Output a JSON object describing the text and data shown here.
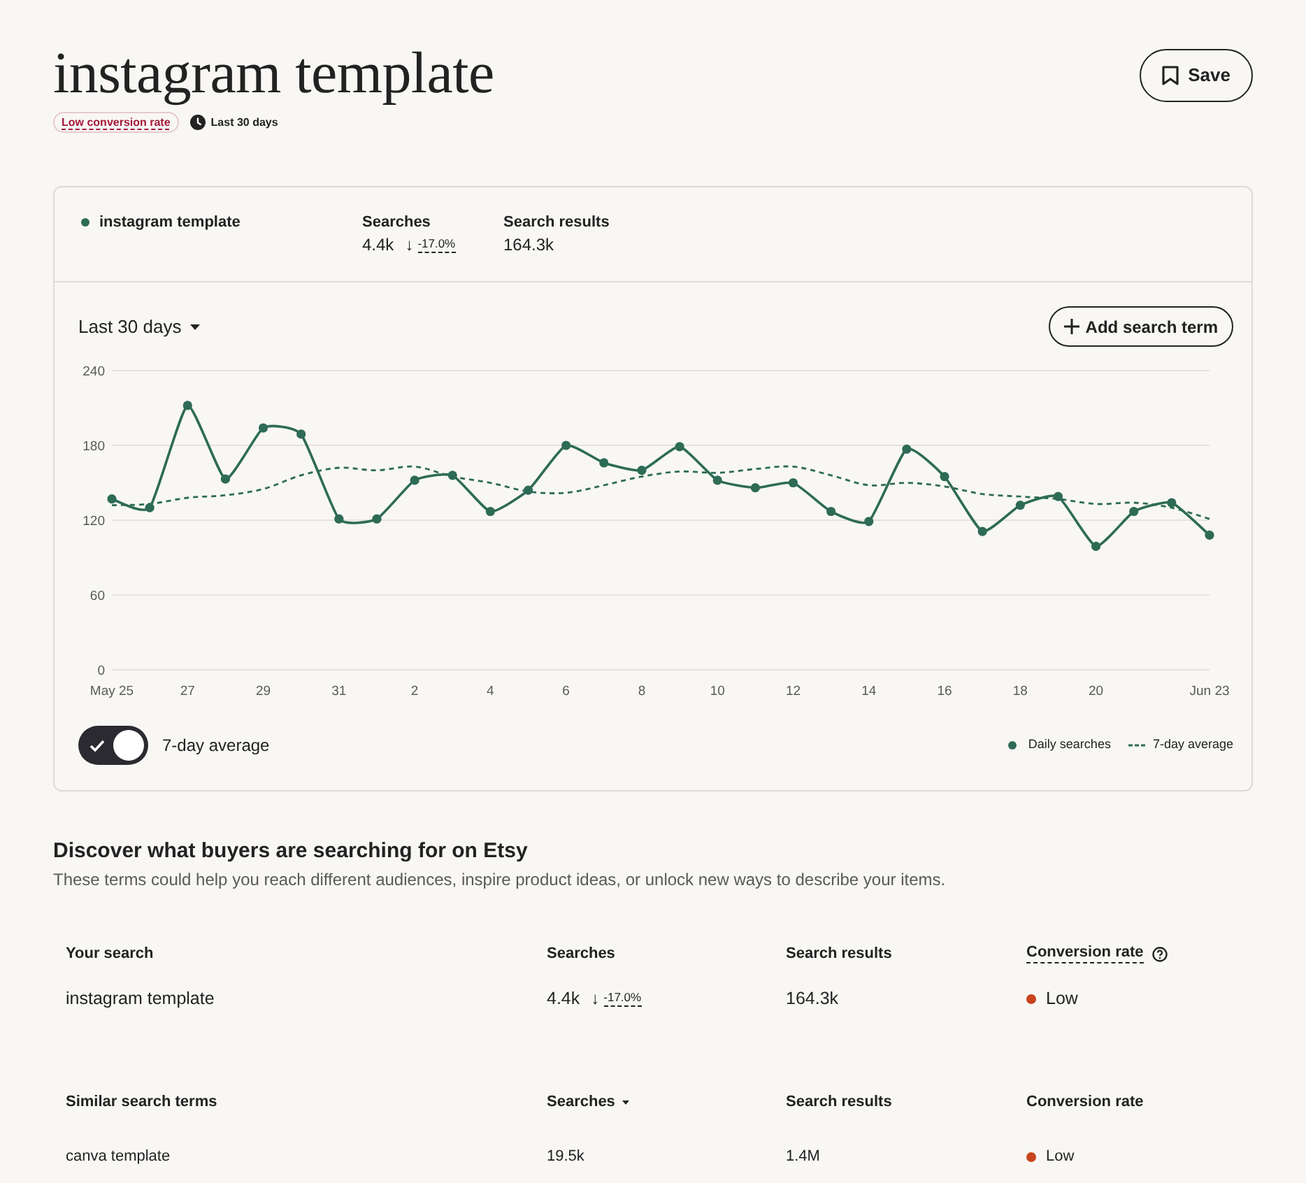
{
  "header": {
    "title": "instagram template",
    "badge": "Low conversion rate",
    "period": "Last 30 days",
    "save_label": "Save"
  },
  "summary": {
    "term": "instagram template",
    "color": "#2e6b56",
    "stats": [
      {
        "label": "Searches",
        "value": "4.4k",
        "arrow": "↓",
        "change": "-17.0%"
      },
      {
        "label": "Search results",
        "value": "164.3k"
      }
    ]
  },
  "chart_panel": {
    "range": "Last 30 days",
    "add_button": "Add search term",
    "chart_data": {
      "type": "line",
      "grid": true,
      "categories": [
        "May 25",
        null,
        "27",
        null,
        "29",
        null,
        "31",
        null,
        "2",
        null,
        "4",
        null,
        "6",
        null,
        "8",
        null,
        "10",
        null,
        "12",
        null,
        "14",
        null,
        "16",
        null,
        "18",
        null,
        "20",
        null,
        null,
        "Jun 23"
      ],
      "ylim": [
        0,
        240
      ],
      "yticks": [
        0,
        60,
        120,
        180,
        240
      ],
      "series": [
        {
          "name": "Daily searches",
          "color": "#2e6b56",
          "line_style": "solid",
          "marker": "circle",
          "values": [
            137,
            130,
            212,
            153,
            194,
            189,
            121,
            121,
            152,
            156,
            127,
            144,
            180,
            166,
            160,
            179,
            152,
            146,
            150,
            127,
            119,
            177,
            155,
            111,
            132,
            139,
            99,
            127,
            134,
            108
          ]
        },
        {
          "name": "7-day average",
          "color": "#2e6b56",
          "line_style": "dashed",
          "marker": "none",
          "values": [
            132,
            133,
            138,
            140,
            145,
            156,
            162,
            160,
            163,
            155,
            150,
            143,
            142,
            148,
            155,
            159,
            158,
            161,
            163,
            156,
            148,
            150,
            147,
            141,
            139,
            137,
            133,
            134,
            130,
            121
          ]
        }
      ]
    },
    "average_toggle": {
      "label": "7-day average",
      "on": true
    }
  },
  "discover": {
    "title": "Discover what buyers are searching for on Etsy",
    "subtitle": "These terms could help you reach different audiences, inspire product ideas, or unlock new ways to describe your items.",
    "tables": [
      {
        "columns": [
          {
            "label": "Your search",
            "kind": "plain"
          },
          {
            "label": "Searches",
            "kind": "plain"
          },
          {
            "label": "Search results",
            "kind": "plain"
          },
          {
            "label": "Conversion rate",
            "kind": "help"
          }
        ],
        "rows": [
          {
            "term": "instagram template",
            "searches": "4.4k",
            "arrow": "↓",
            "change": "-17.0%",
            "results": "164.3k",
            "conversion": "Low",
            "color": "#c8441c"
          }
        ]
      },
      {
        "columns": [
          {
            "label": "Similar search terms",
            "kind": "plain"
          },
          {
            "label": "Searches",
            "kind": "sort"
          },
          {
            "label": "Search results",
            "kind": "plain"
          },
          {
            "label": "Conversion rate",
            "kind": "plain"
          }
        ],
        "rows": [
          {
            "term": "canva template",
            "searches": "19.5k",
            "results": "1.4M",
            "conversion": "Low",
            "color": "#c8441c"
          }
        ]
      }
    ]
  }
}
